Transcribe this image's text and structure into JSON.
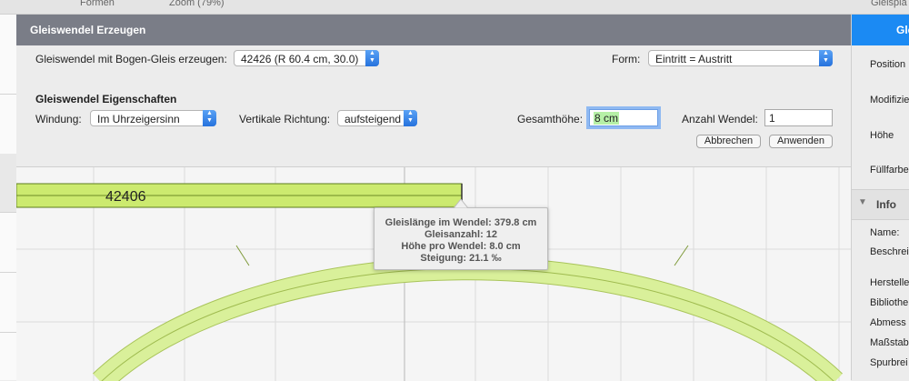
{
  "topbar": {
    "formen": "Formen",
    "zoom": "Zoom (79%)",
    "gleisplan": "Gleispla"
  },
  "dialog": {
    "title": "Gleiswendel Erzeugen",
    "bogen_label": "Gleiswendel mit Bogen-Gleis erzeugen:",
    "bogen_value": "42426 (R 60.4 cm, 30.0)",
    "form_label": "Form:",
    "form_value": "Eintritt = Austritt",
    "section_title": "Gleiswendel Eigenschaften",
    "windung_label": "Windung:",
    "windung_value": "Im Uhrzeigersinn",
    "richtung_label": "Vertikale Richtung:",
    "richtung_value": "aufsteigend",
    "hoehe_label": "Gesamthöhe:",
    "hoehe_value": "8 cm",
    "anzahl_label": "Anzahl Wendel:",
    "anzahl_value": "1",
    "cancel": "Abbrechen",
    "apply": "Anwenden"
  },
  "canvas": {
    "track_label": "42406",
    "tooltip": {
      "line1": "Gleislänge im Wendel: 379.8 cm",
      "line2": "Gleisanzahl: 12",
      "line3": "Höhe pro Wendel: 8.0 cm",
      "line4": "Steigung: 21.1 ‰"
    },
    "track_color": "#d4ec8c",
    "grid_color": "#dcdcdc"
  },
  "sidebar": {
    "tab": "Glei",
    "position": "Position",
    "modifizieren": "Modifizie",
    "hoehe": "Höhe",
    "fuellfarbe": "Füllfarbe",
    "info": "Info",
    "name": "Name:",
    "beschreibung": "Beschrei",
    "hersteller": "Herstelle",
    "bibliothek": "Bibliothe",
    "abmessung": "Abmess",
    "massstab": "Maßstab",
    "spurbreite": "Spurbrei"
  }
}
